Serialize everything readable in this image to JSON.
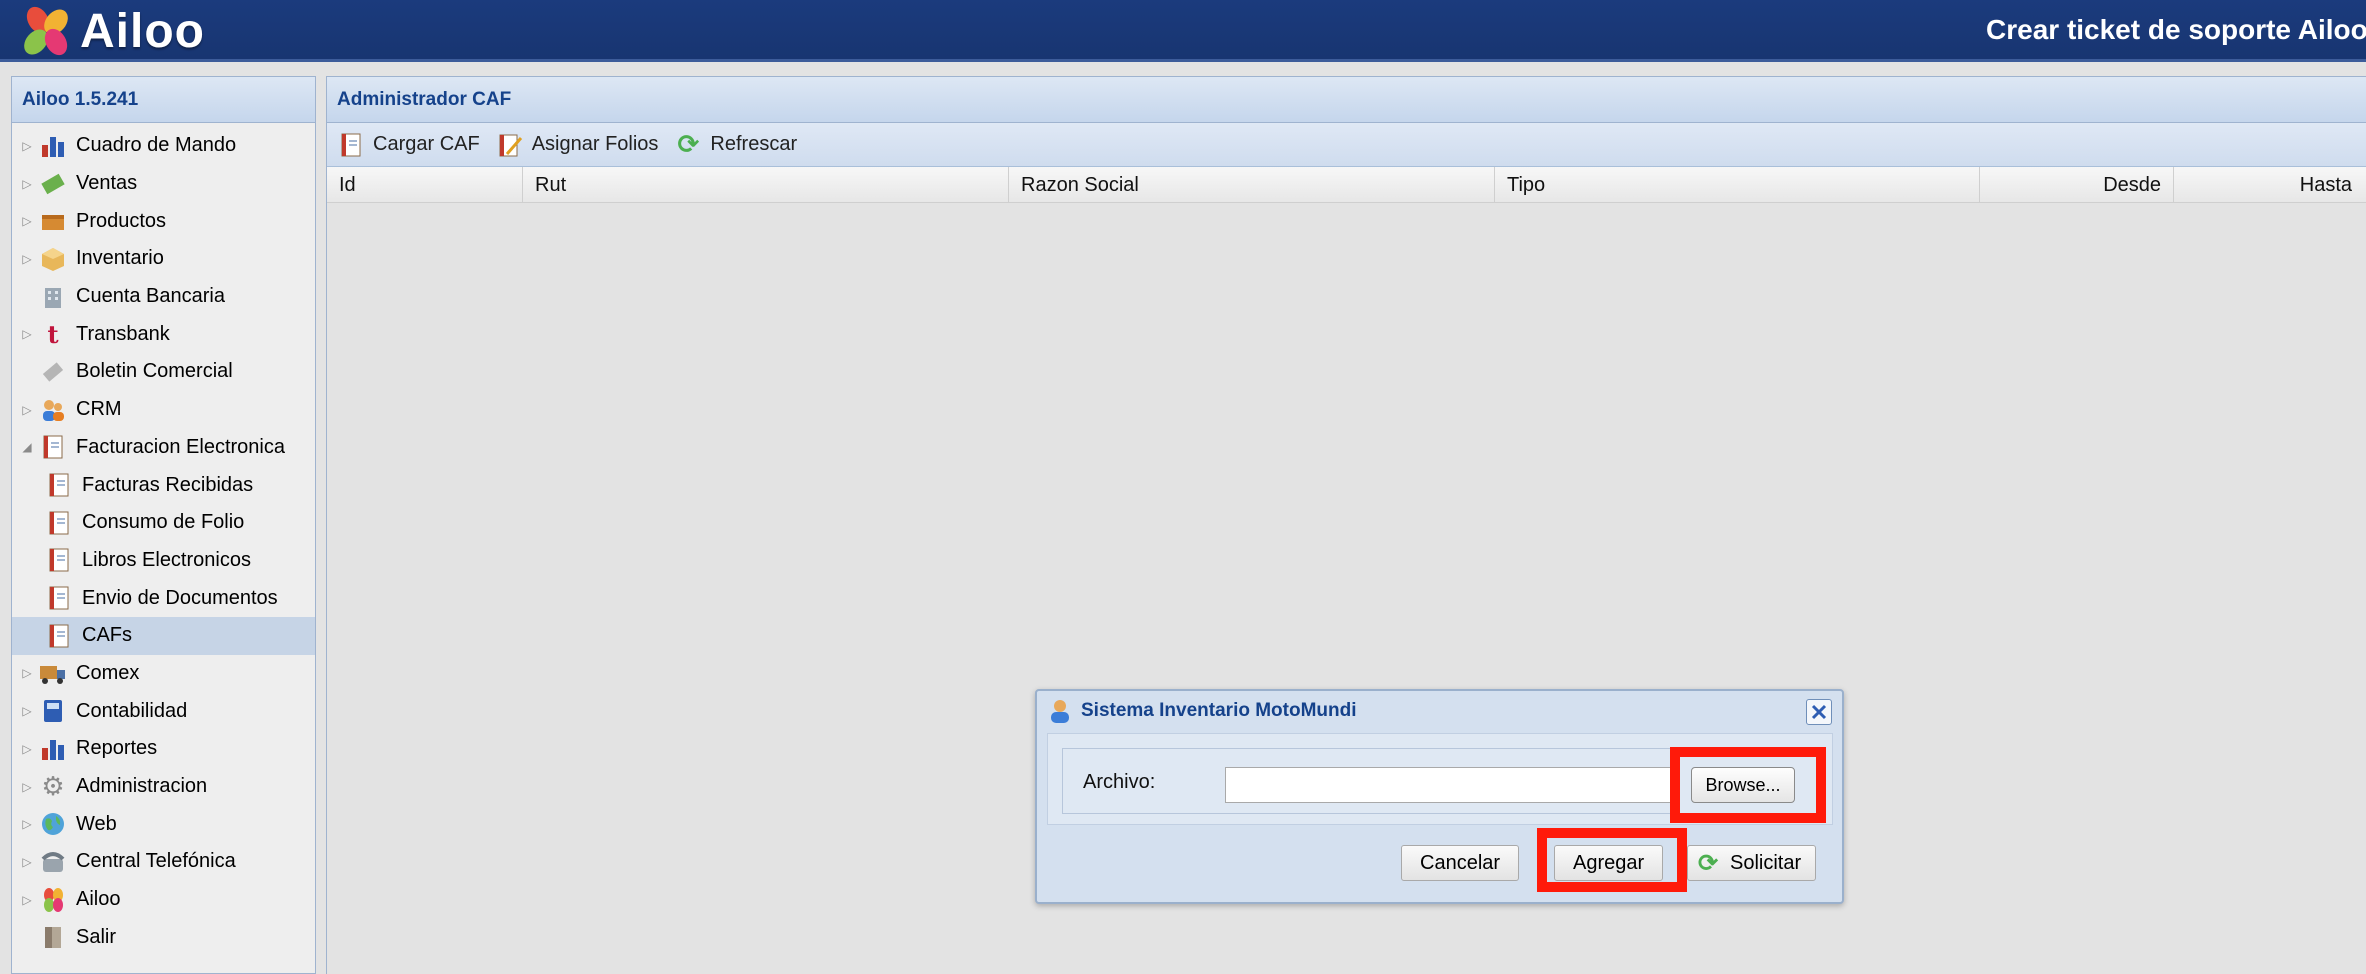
{
  "header": {
    "brand": "Ailoo",
    "support_link": "Crear ticket de soporte Ailoo"
  },
  "sidebar": {
    "title": "Ailoo 1.5.241",
    "items": [
      {
        "label": "Cuadro de Mando",
        "icon": "chart-icon"
      },
      {
        "label": "Ventas",
        "icon": "money-icon"
      },
      {
        "label": "Productos",
        "icon": "box-icon"
      },
      {
        "label": "Inventario",
        "icon": "package-icon"
      },
      {
        "label": "Cuenta Bancaria",
        "icon": "bank-icon"
      },
      {
        "label": "Transbank",
        "icon": "transbank-icon"
      },
      {
        "label": "Boletin Comercial",
        "icon": "ticket-icon"
      },
      {
        "label": "CRM",
        "icon": "users-icon"
      },
      {
        "label": "Facturacion Electronica",
        "icon": "document-icon"
      },
      {
        "label": "Facturas Recibidas",
        "icon": "document-icon"
      },
      {
        "label": "Consumo de Folio",
        "icon": "document-icon"
      },
      {
        "label": "Libros Electronicos",
        "icon": "document-icon"
      },
      {
        "label": "Envio de Documentos",
        "icon": "document-icon"
      },
      {
        "label": "CAFs",
        "icon": "document-icon"
      },
      {
        "label": "Comex",
        "icon": "truck-icon"
      },
      {
        "label": "Contabilidad",
        "icon": "ledger-icon"
      },
      {
        "label": "Reportes",
        "icon": "chart-icon"
      },
      {
        "label": "Administracion",
        "icon": "gear-icon"
      },
      {
        "label": "Web",
        "icon": "globe-icon"
      },
      {
        "label": "Central Telefónica",
        "icon": "phone-icon"
      },
      {
        "label": "Ailoo",
        "icon": "ailoo-icon"
      },
      {
        "label": "Salir",
        "icon": "exit-icon"
      }
    ]
  },
  "main": {
    "title": "Administrador CAF",
    "toolbar": {
      "cargar": "Cargar CAF",
      "asignar": "Asignar Folios",
      "refrescar": "Refrescar"
    },
    "columns": [
      "Id",
      "Rut",
      "Razon Social",
      "Tipo",
      "Desde",
      "Hasta"
    ]
  },
  "dialog": {
    "title": "Sistema Inventario MotoMundi",
    "field_label": "Archivo:",
    "file_value": "",
    "browse": "Browse...",
    "cancel": "Cancelar",
    "add": "Agregar",
    "request": "Solicitar"
  },
  "colors": {
    "header_bg": "#1b3b7d",
    "panel_title": "#15428b",
    "highlight": "#ff1a0a"
  }
}
